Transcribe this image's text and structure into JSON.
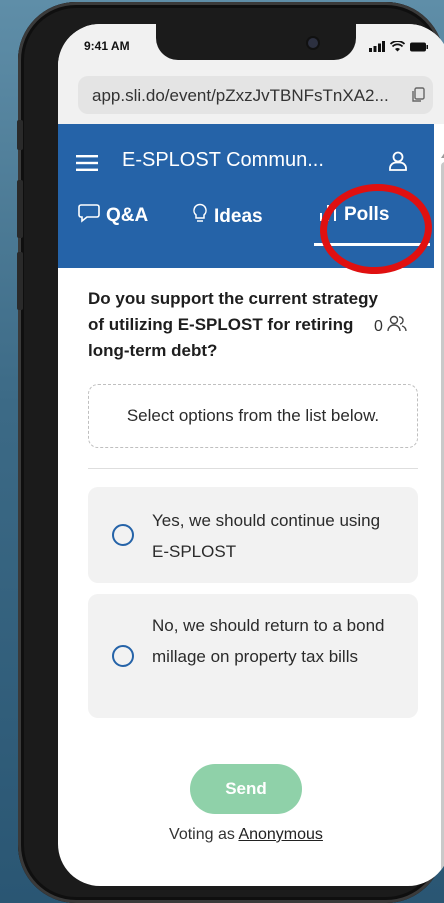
{
  "status_bar": {
    "time": "9:41 AM"
  },
  "browser": {
    "url": "app.sli.do/event/pZxzJvTBNFsTnXA2..."
  },
  "header": {
    "event_title": "E-SPLOST Commun...",
    "tabs": [
      {
        "label": "Q&A",
        "icon": "chat-bubble-icon"
      },
      {
        "label": "Ideas",
        "icon": "lightbulb-icon"
      },
      {
        "label": "Polls",
        "icon": "bar-chart-icon",
        "active": true
      }
    ]
  },
  "poll": {
    "question": "Do you support the current strategy of utilizing E-SPLOST for retiring long-term debt?",
    "participant_count": "0",
    "instruction": "Select options from the list below.",
    "options": [
      {
        "label": "Yes, we should continue using E-SPLOST"
      },
      {
        "label": "No, we should return to a bond millage on property tax bills"
      }
    ],
    "send_label": "Send",
    "voting_prefix": "Voting as",
    "voting_name": "Anonymous"
  },
  "colors": {
    "brand": "#2563a8",
    "send_button": "#8fd1a9",
    "highlight": "#e01010"
  }
}
